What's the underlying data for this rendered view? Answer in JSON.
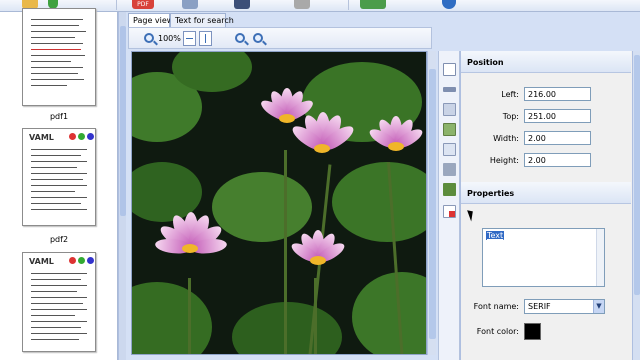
{
  "toolbar": {
    "pdf_badge": "PDF"
  },
  "thumbnails": [
    {
      "label": "pdf1",
      "header": ""
    },
    {
      "label": "pdf2",
      "header": "VAML"
    },
    {
      "label": "",
      "header": "VAML"
    }
  ],
  "tabs": [
    {
      "label": "Page view",
      "active": true
    },
    {
      "label": "Text for search",
      "active": false
    }
  ],
  "viewbar": {
    "zoom": "100%"
  },
  "position": {
    "title": "Position",
    "left_label": "Left:",
    "left_value": "216.00",
    "top_label": "Top:",
    "top_value": "251.00",
    "width_label": "Width:",
    "width_value": "2.00",
    "height_label": "Height:",
    "height_value": "2.00"
  },
  "properties": {
    "title": "Properties",
    "text_value": "Text",
    "font_name_label": "Font name:",
    "font_name_value": "SERIF",
    "font_color_label": "Font color:",
    "font_color": "#000000"
  },
  "colors": {
    "accent": "#316ac5",
    "panel_bg": "#f0f0f0",
    "flower_pink": "#c35bb7"
  }
}
